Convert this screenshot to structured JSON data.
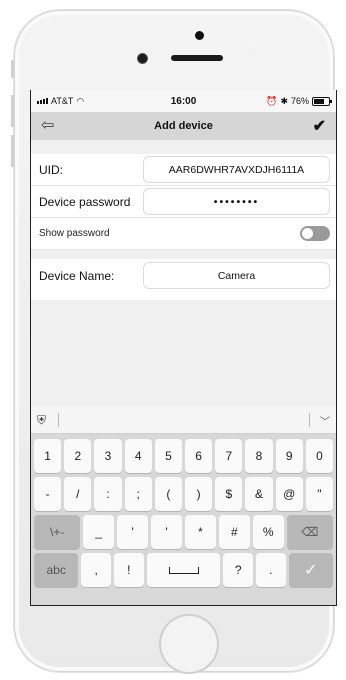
{
  "status_bar": {
    "carrier": "AT&T",
    "time": "16:00",
    "battery": "76%"
  },
  "nav": {
    "title": "Add device"
  },
  "form": {
    "uid_label": "UID:",
    "uid_value": "AAR6DWHR7AVXDJH6111A",
    "password_label": "Device password",
    "password_value": "••••••••",
    "show_password_label": "Show password",
    "show_password_on": false,
    "device_name_label": "Device Name:",
    "device_name_value": "Camera"
  },
  "keyboard": {
    "row1": [
      "1",
      "2",
      "3",
      "4",
      "5",
      "6",
      "7",
      "8",
      "9",
      "0"
    ],
    "row2": [
      "-",
      "/",
      ":",
      ";",
      "(",
      ")",
      "$",
      "&",
      "@",
      "\""
    ],
    "row3": [
      "\\+-",
      "_",
      "'",
      "'",
      "*",
      "#",
      "%",
      "⌫"
    ],
    "row4_abc": "abc",
    "row4_comma": ",",
    "row4_excl": "!",
    "row4_question": "?",
    "row4_period": ".",
    "row4_enter": "✓"
  },
  "colors": {
    "navbar": "#d6d6d6",
    "background": "#f0f0f0",
    "keyboard": "#d8d8d8"
  }
}
